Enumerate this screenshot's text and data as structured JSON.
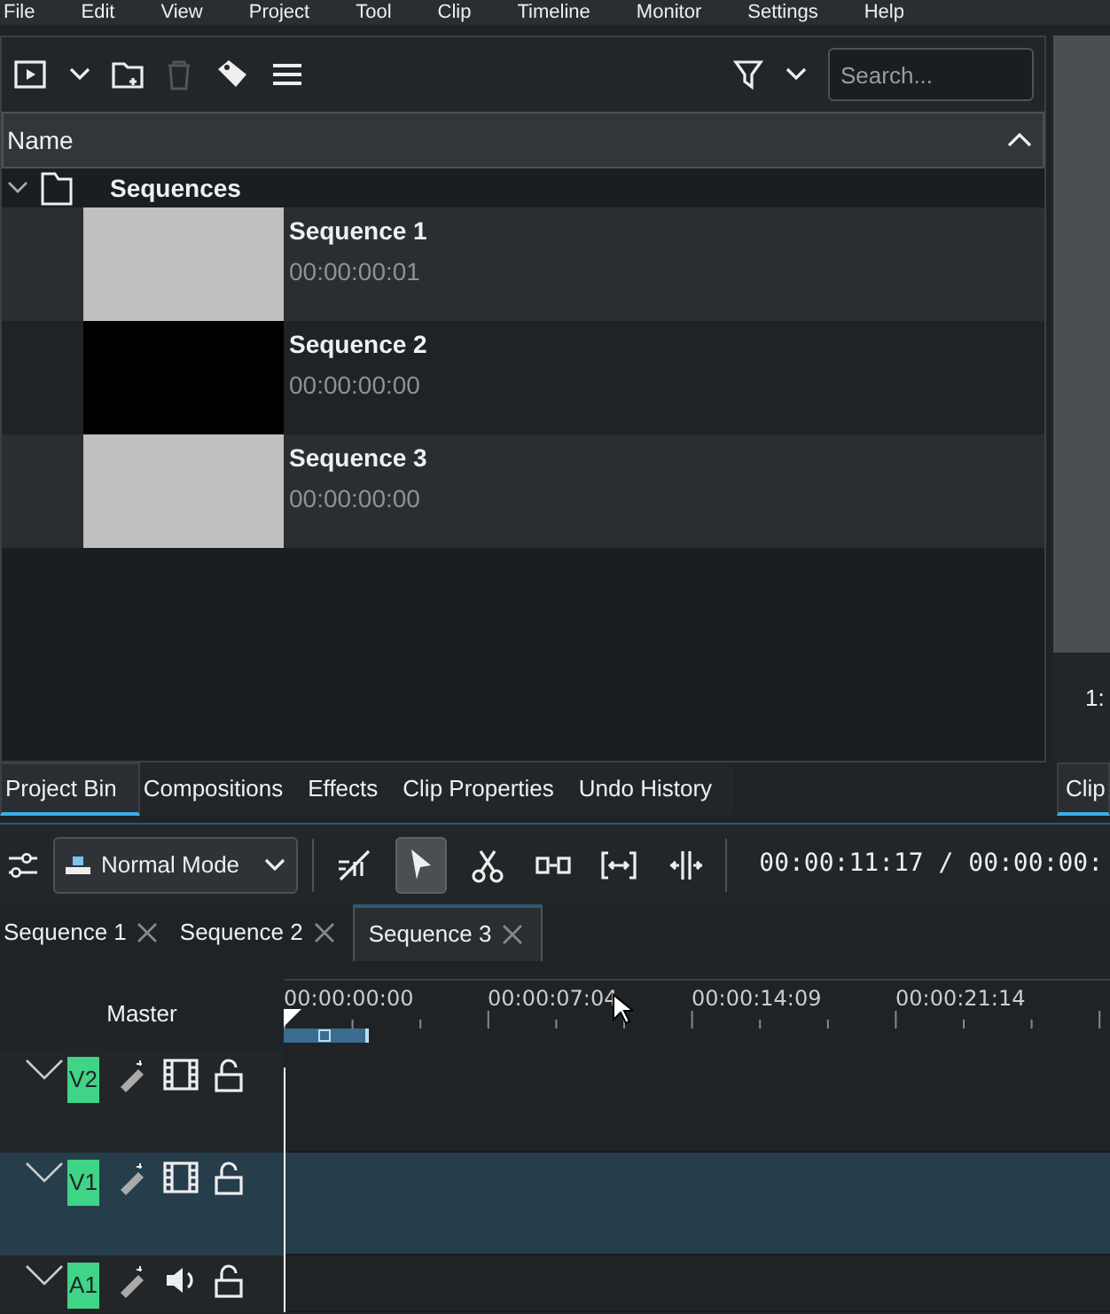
{
  "menu": [
    "File",
    "Edit",
    "View",
    "Project",
    "Tool",
    "Clip",
    "Timeline",
    "Monitor",
    "Settings",
    "Help"
  ],
  "bin": {
    "search": {
      "placeholder": "Search..."
    },
    "column": "Name",
    "folder": {
      "name": "Sequences",
      "expanded": true,
      "children": [
        {
          "name": "Sequence 1",
          "duration": "00:00:00:01",
          "color": "#c0c0c0"
        },
        {
          "name": "Sequence 2",
          "duration": "00:00:00:00",
          "color": "#000000"
        },
        {
          "name": "Sequence 3",
          "duration": "00:00:00:00",
          "color": "#c0c0c0"
        }
      ]
    }
  },
  "monitor": {
    "timecode": "1:",
    "tab": "Clip"
  },
  "dock_tabs": [
    {
      "label": "Project Bin",
      "selected": true
    },
    {
      "label": "Compositions",
      "selected": false
    },
    {
      "label": "Effects",
      "selected": false
    },
    {
      "label": "Clip Properties",
      "selected": false
    },
    {
      "label": "Undo History",
      "selected": false
    }
  ],
  "timeline": {
    "mode": "Normal Mode",
    "tools": [
      {
        "kind": "spacer",
        "selected": false
      },
      {
        "kind": "select",
        "selected": true
      },
      {
        "kind": "razor",
        "selected": false
      },
      {
        "kind": "slip",
        "selected": false
      },
      {
        "kind": "ripple",
        "selected": false
      },
      {
        "kind": "slide",
        "selected": false
      }
    ],
    "timecode": "00:00:11:17 / 00:00:00:",
    "sequences": [
      {
        "label": "Sequence 1",
        "selected": false
      },
      {
        "label": "Sequence 2",
        "selected": false
      },
      {
        "label": "Sequence 3",
        "selected": true
      }
    ],
    "master": "Master",
    "ticks": [
      "00:00:00:00",
      "00:00:07:04",
      "00:00:14:09",
      "00:00:21:14"
    ],
    "tracks": [
      {
        "name": "V2",
        "kind": "video",
        "selected": false
      },
      {
        "name": "V1",
        "kind": "video",
        "selected": true
      },
      {
        "name": "A1",
        "kind": "audio",
        "selected": false
      }
    ]
  }
}
